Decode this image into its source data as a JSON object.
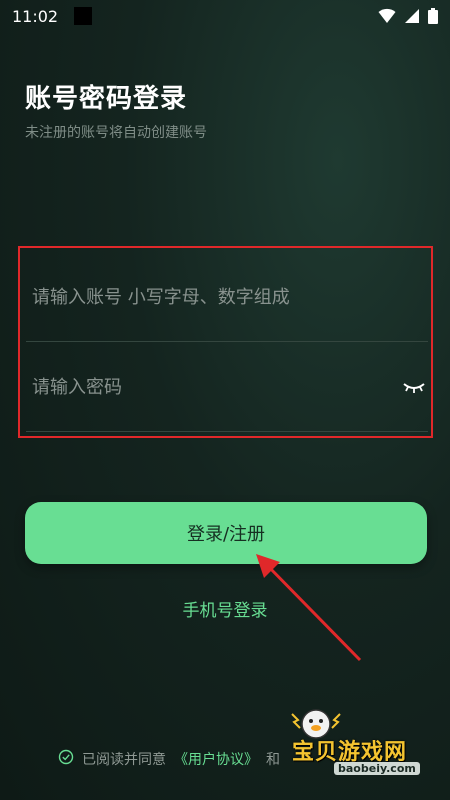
{
  "status_bar": {
    "time": "11:02"
  },
  "header": {
    "title": "账号密码登录",
    "subtitle": "未注册的账号将自动创建账号"
  },
  "form": {
    "account": {
      "placeholder": "请输入账号 小写字母、数字组成",
      "value": ""
    },
    "password": {
      "placeholder": "请输入密码",
      "value": ""
    }
  },
  "actions": {
    "login_label": "登录/注册",
    "phone_login_label": "手机号登录"
  },
  "agreement": {
    "prefix": "已阅读并同意",
    "user_agreement": "《用户协议》",
    "connector": "和"
  },
  "watermark": {
    "title": "宝贝游戏网",
    "url": "baobeiy.com"
  },
  "icons": {
    "wifi": "wifi-icon",
    "signal": "signal-icon",
    "battery": "battery-icon",
    "eye": "eye-closed-icon",
    "check": "check-circle-icon"
  },
  "colors": {
    "accent": "#68de93",
    "highlight_box": "#e0282a",
    "arrow": "#e0282a"
  }
}
